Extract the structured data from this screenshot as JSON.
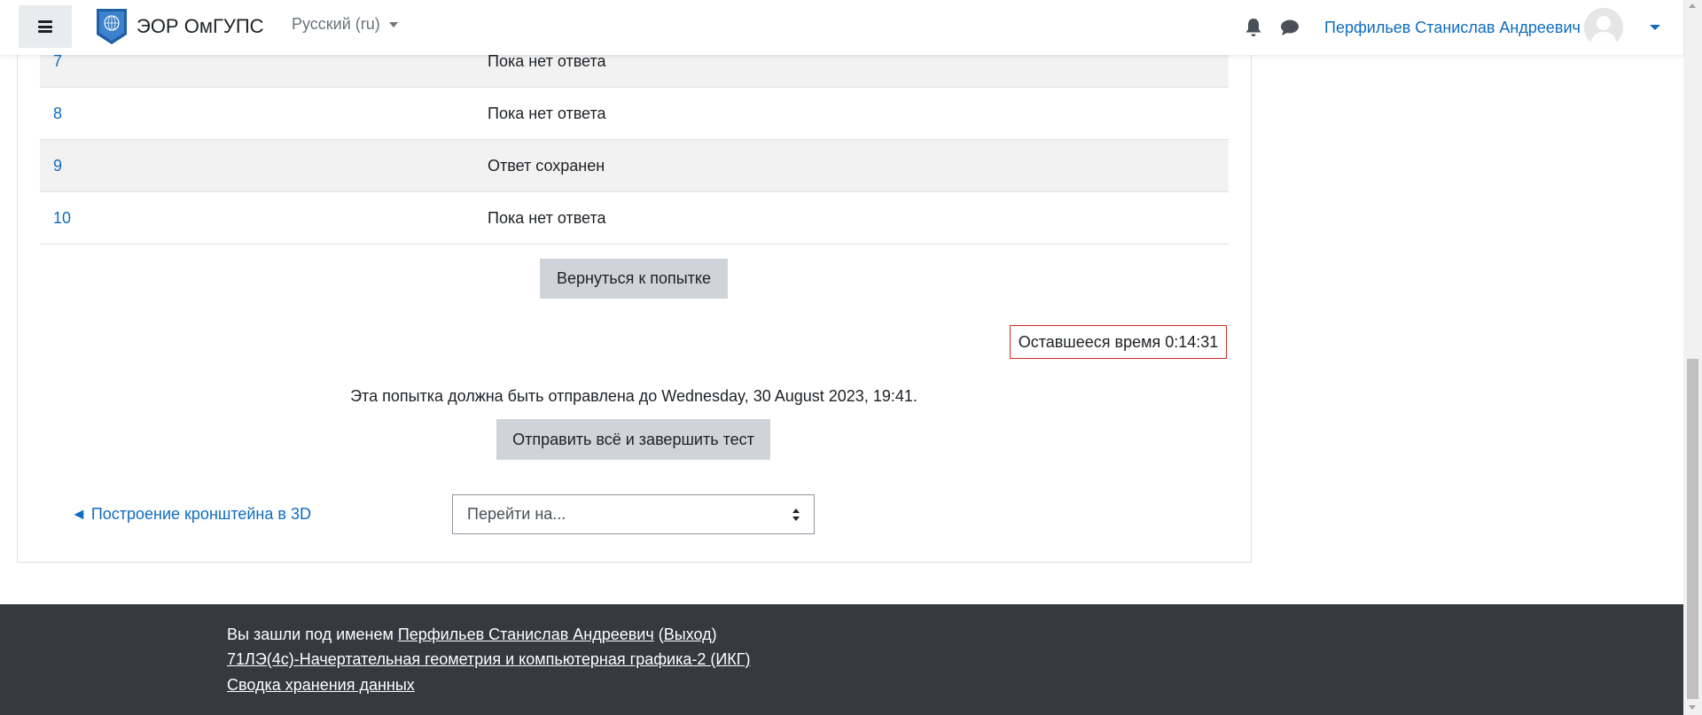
{
  "brand": {
    "name": "ЭОР ОмГУПС"
  },
  "language": {
    "label": "Русский (ru)"
  },
  "user": {
    "name": "Перфильев Станислав Андреевич"
  },
  "summary": {
    "rows": [
      {
        "number": "7",
        "status": "Пока нет ответа"
      },
      {
        "number": "8",
        "status": "Пока нет ответа"
      },
      {
        "number": "9",
        "status": "Ответ сохранен"
      },
      {
        "number": "10",
        "status": "Пока нет ответа"
      }
    ]
  },
  "actions": {
    "return_label": "Вернуться к попытке",
    "submit_label": "Отправить всё и завершить тест"
  },
  "timer": {
    "label": "Оставшееся время",
    "value": "0:14:31"
  },
  "deadline": {
    "text": "Эта попытка должна быть отправлена до Wednesday, 30 August 2023, 19:41."
  },
  "navigation": {
    "prev_label": "◄ Построение кронштейна в 3D",
    "jump_placeholder": "Перейти на..."
  },
  "footer": {
    "logged_in_prefix": "Вы зашли под именем",
    "user_name": "Перфильев Станислав Андреевич",
    "logout_label": "Выход",
    "course_link": "71ЛЭ(4с)-Начертательная геометрия и компьютерная графика-2 (ИКГ)",
    "data_retention_link": "Сводка хранения данных"
  },
  "colors": {
    "link": "#0f6cbf",
    "button_bg": "#ced4da",
    "timer_border": "#ca3120",
    "footer_bg": "#343a40"
  }
}
